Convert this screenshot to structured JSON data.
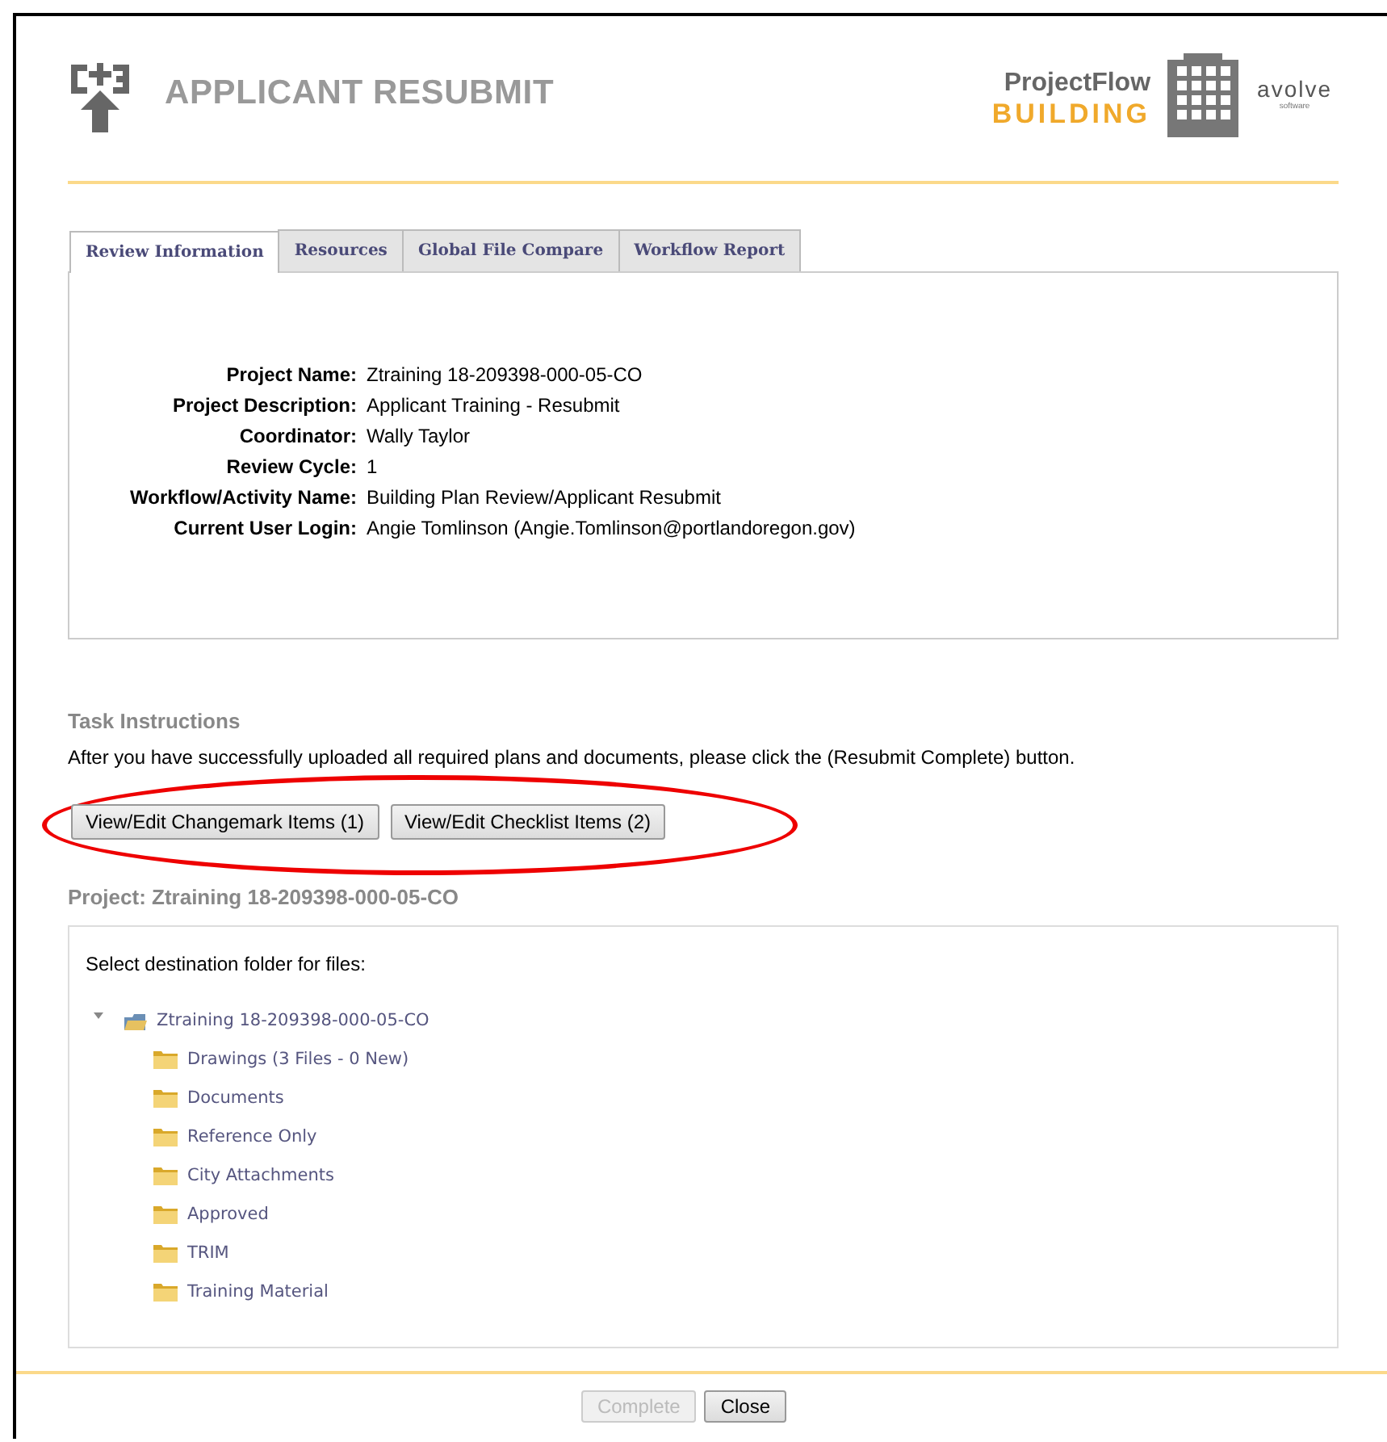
{
  "header": {
    "title": "APPLICANT RESUBMIT",
    "brand_top": "ProjectFlow",
    "brand_bottom": "BUILDING",
    "vendor": "avolve",
    "vendor_sub": "software"
  },
  "tabs": [
    {
      "label": "Review Information",
      "selected": true
    },
    {
      "label": "Resources",
      "selected": false
    },
    {
      "label": "Global File Compare",
      "selected": false
    },
    {
      "label": "Workflow Report",
      "selected": false
    }
  ],
  "info": [
    {
      "label": "Project Name:",
      "value": "Ztraining 18-209398-000-05-CO"
    },
    {
      "label": "Project Description:",
      "value": "Applicant Training - Resubmit"
    },
    {
      "label": "Coordinator:",
      "value": "Wally Taylor"
    },
    {
      "label": "Review Cycle:",
      "value": "1"
    },
    {
      "label": "Workflow/Activity Name:",
      "value": "Building Plan Review/Applicant Resubmit"
    },
    {
      "label": "Current User Login:",
      "value": "Angie Tomlinson (Angie.Tomlinson@portlandoregon.gov)"
    }
  ],
  "task": {
    "heading": "Task Instructions",
    "text": "After you have successfully uploaded all required plans and documents, please click the (Resubmit Complete) button.",
    "buttons": [
      "View/Edit Changemark Items (1)",
      "View/Edit Checklist Items (2)"
    ],
    "highlighted": true
  },
  "project": {
    "heading": "Project: Ztraining 18-209398-000-05-CO",
    "prompt": "Select destination folder for files:",
    "tree": [
      {
        "label": "Ztraining 18-209398-000-05-CO",
        "expanded": true,
        "children": [
          {
            "label": "Drawings (3 Files - 0 New)"
          },
          {
            "label": "Documents"
          },
          {
            "label": "Reference Only"
          },
          {
            "label": "City Attachments"
          },
          {
            "label": "Approved"
          },
          {
            "label": "TRIM"
          },
          {
            "label": "Training Material"
          }
        ]
      }
    ]
  },
  "footer_buttons": [
    {
      "label": "Complete",
      "disabled": true
    },
    {
      "label": "Close",
      "disabled": false
    }
  ]
}
